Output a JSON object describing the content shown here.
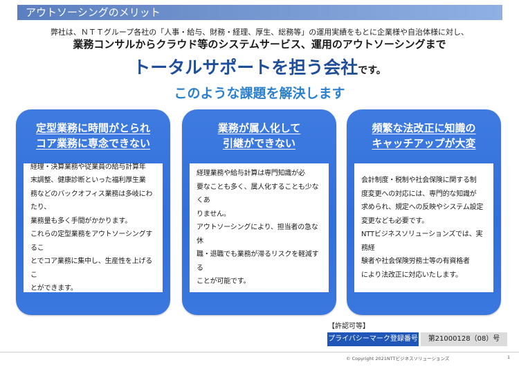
{
  "header": {
    "title": "アウトソーシングのメリット"
  },
  "intro": {
    "line1": "弊社は、ＮＴＴグループ各社の「人事・給与、財務・経理、厚生、総務等」の運用実績をもとに企業様や自治体様に対し、",
    "line2": "業務コンサルからクラウド等のシステムサービス、運用のアウトソーシングまで",
    "line3_main": "トータルサポートを担う会社",
    "line3_suffix": "です。",
    "line4": "このような課題を解決します"
  },
  "cards": [
    {
      "title_line1": "定型業務に時間がとられ",
      "title_line2": "コア業務に専念できない",
      "body": "経理・決算業務や従業員の給与計算年\n末調整、健康診断といった福利厚生業\n務などのバックオフィス業務は多岐にわたり、\n業務量も多く手間がかかります。\nこれらの定型業務をアウトソーシングするこ\nとでコア業務に集中し、生産性を上げるこ\nとができます。"
    },
    {
      "title_line1": "業務が属人化して",
      "title_line2": "引継ができない",
      "body": "経理業務や給与計算は専門知識が必\n要なことも多く、属人化することも少なくあ\nりません。\nアウトソーシングにより、担当者の急な休\n職・退職でも業務が滞るリスクを軽減する\nことが可能です。"
    },
    {
      "title_line1": "頻繁な法改正に知識の",
      "title_line2": "キャッチアップが大変",
      "body": "会計制度・税制や社会保険に関する制\n度変更への対応には、専門的な知識が\n求められ、規定への反映やシステム設定\n変更なども必要です。\nNTTビジネスソリューションズでは、実務経\n験者や社会保険労務士等の有資格者\nにより法改正に対応いたします。"
    }
  ],
  "permit": {
    "label": "【許認可等】",
    "name": "プライバシーマーク登録番号",
    "number": "第21000128（08）号"
  },
  "footer": {
    "copyright": "© Copyright 2021NTTビジネスソリューションズ",
    "page": "1"
  },
  "colors": {
    "card_blue": "#2f6fdc",
    "headline_navy": "#1f4e9a",
    "subheadline_blue": "#2a7fce"
  }
}
